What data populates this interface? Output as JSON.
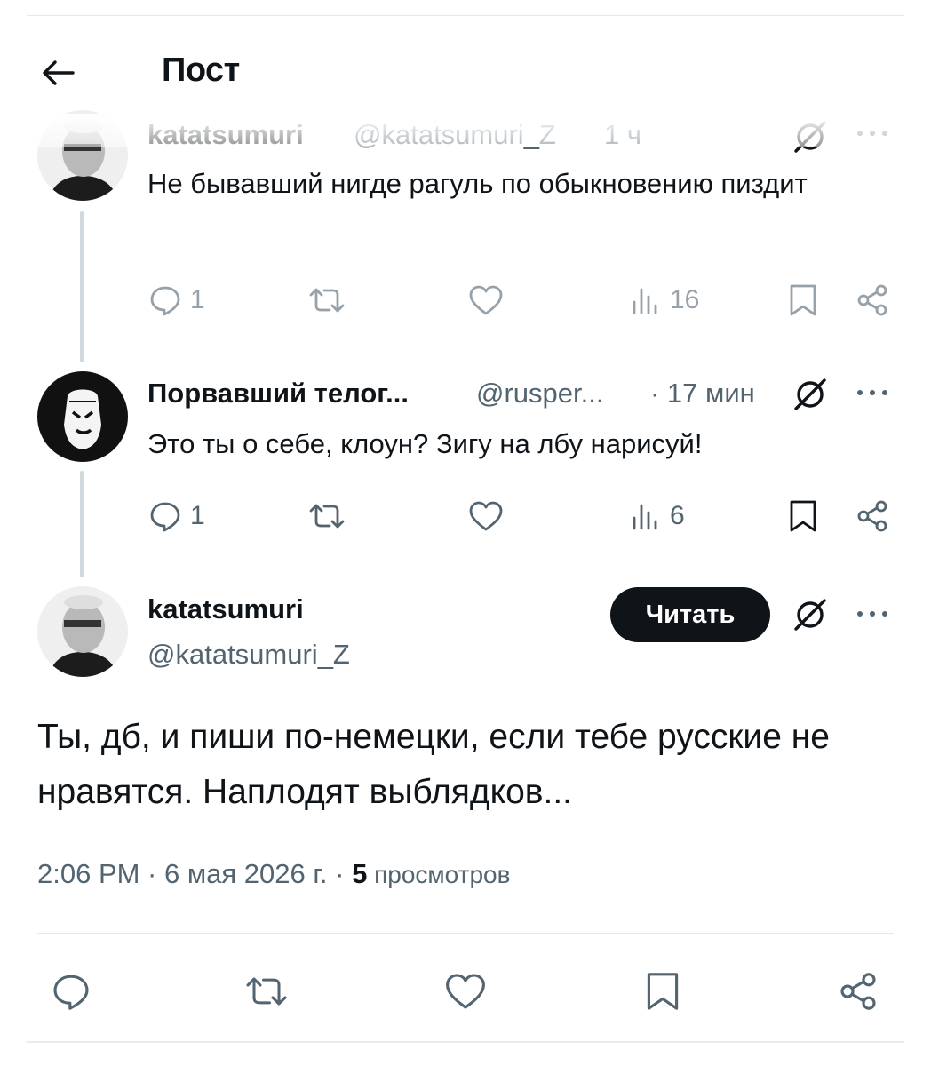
{
  "header": {
    "title": "Пост",
    "back_icon": "arrow-left-icon"
  },
  "tweets": [
    {
      "name": "katatsumuri",
      "handle": "@katatsumuri_Z",
      "time": "1 ч",
      "text": "Не бывавший нигде рагуль по обыкновению пиздит",
      "replies": "1",
      "views": "16"
    },
    {
      "name": "Порвавший телог...",
      "handle": "@rusper...",
      "time": "· 17 мин",
      "text": "Это ты о себе, клоун? Зигу на лбу нарисуй!",
      "replies": "1",
      "views": "6"
    }
  ],
  "main_tweet": {
    "name": "katatsumuri",
    "handle": "@katatsumuri_Z",
    "follow_label": "Читать",
    "text": "Ты, дб, и пиши по-немецки, если тебе русские не нравятся. Наплодят выблядков...",
    "time_date": "2:06 PM · 6 мая 2026 г. · ",
    "views_count": "5",
    "views_label": " просмотров"
  },
  "colors": {
    "text": "#0f1419",
    "secondary": "#536471",
    "line": "#cfd9de",
    "button_bg": "#0f1419"
  }
}
